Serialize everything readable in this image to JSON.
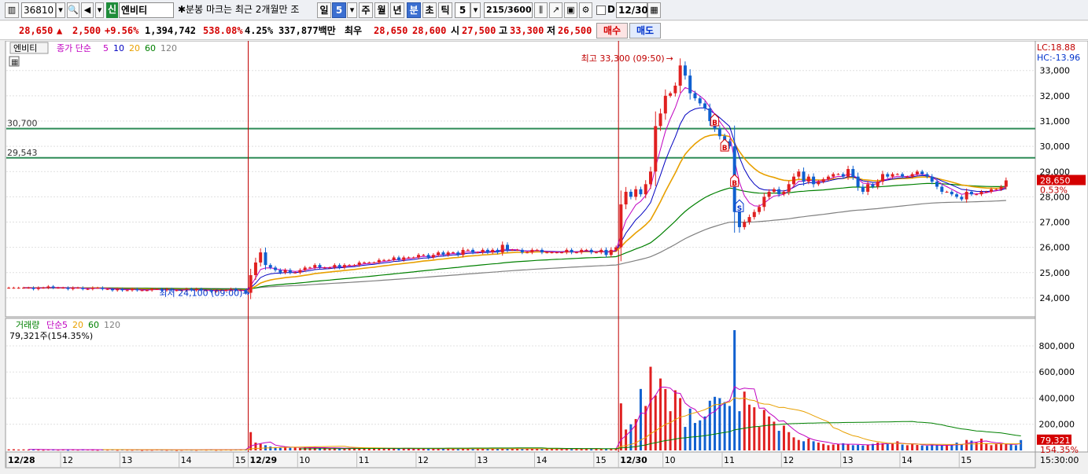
{
  "toolbar": {
    "code": "36810",
    "market_badge": "신",
    "stock_name": "엔비티",
    "notice": "✱분봉 마크는 최근 2개월만 조",
    "periods": [
      "일",
      "5",
      "주",
      "월",
      "년",
      "분",
      "초",
      "틱"
    ],
    "active_period": "분",
    "interval_value": "5",
    "count_display": "215/3600",
    "d_label": "D",
    "date_value": "12/30"
  },
  "quote": {
    "price": "28,650",
    "change_arrow": "▲",
    "change": "2,500",
    "change_pct": "+9.56%",
    "volume": "1,394,742",
    "volume_ratio": "538.08%",
    "turnover_pct": "4.25%",
    "trade_value": "337,877백만",
    "best_label": "최우",
    "ask": "28,650",
    "bid": "28,600",
    "open_label": "시",
    "open": "27,500",
    "high_label": "고",
    "high": "33,300",
    "low_label": "저",
    "low": "26,500",
    "buy_button": "매수",
    "sell_button": "매도"
  },
  "price_pane": {
    "name_tag": "엔비티",
    "legend": [
      {
        "text": "종가 단순",
        "color": "#c000c0"
      },
      {
        "text": "5",
        "color": "#c000c0"
      },
      {
        "text": "10",
        "color": "#0000c0"
      },
      {
        "text": "20",
        "color": "#e8a000"
      },
      {
        "text": "60",
        "color": "#008000"
      },
      {
        "text": "120",
        "color": "#808080"
      }
    ],
    "lc_label": "LC:18.88",
    "hc_label": "HC:-13.96",
    "hline1": "30,700",
    "hline2": "29,543",
    "max_annotation": "최고 33,300 (09:50)",
    "min_annotation": "최저 24,100 (09:00)",
    "last_price_tag": "28,650",
    "last_pct_tag": "0.53%",
    "y_ticks": [
      "33,000",
      "32,000",
      "31,000",
      "30,000",
      "29,000",
      "28,000",
      "27,000",
      "26,000",
      "25,000",
      "24,000"
    ],
    "signals": [
      "B",
      "B",
      "B",
      "S"
    ]
  },
  "volume_pane": {
    "legend": [
      {
        "text": "거래량",
        "color": "#008000"
      },
      {
        "text": "단순",
        "color": "#c000c0"
      },
      {
        "text": "5",
        "color": "#c000c0"
      },
      {
        "text": "20",
        "color": "#e8a000"
      },
      {
        "text": "60",
        "color": "#008000"
      },
      {
        "text": "120",
        "color": "#808080"
      }
    ],
    "sub_label": "79,321주(154.35%)",
    "y_ticks": [
      "800,000",
      "600,000",
      "400,000",
      "200,000"
    ],
    "last_vol_tag": "79,321",
    "last_pct_tag": "154.35%"
  },
  "x_axis": {
    "labels": [
      "12/28",
      "12",
      "13",
      "14",
      "15",
      "12/29",
      "10",
      "11",
      "12",
      "13",
      "14",
      "15",
      "12/30",
      "10",
      "11",
      "12",
      "13",
      "14",
      "15"
    ],
    "time_label": "15:30:00"
  },
  "chart_data": {
    "type": "candlestick",
    "price_range": [
      23500,
      33800
    ],
    "volume_range": [
      0,
      950000
    ],
    "days": [
      "12/28",
      "12/29",
      "12/30"
    ],
    "close": [
      24400,
      24400,
      24400,
      24400,
      24400,
      24350,
      24400,
      24400,
      24450,
      24400,
      24400,
      24400,
      24350,
      24400,
      24400,
      24350,
      24350,
      24400,
      24400,
      24350,
      24350,
      24300,
      24350,
      24300,
      24300,
      24350,
      24300,
      24300,
      24300,
      24350,
      24350,
      24300,
      24350,
      24300,
      24300,
      24300,
      24350,
      24300,
      24350,
      24300,
      24300,
      24250,
      24300,
      24300,
      24300,
      24350,
      24300,
      24300,
      24200,
      24900,
      25400,
      25800,
      25300,
      25200,
      25100,
      25000,
      25100,
      25000,
      25000,
      25100,
      25200,
      25200,
      25300,
      25200,
      25200,
      25200,
      25300,
      25200,
      25300,
      25300,
      25300,
      25400,
      25400,
      25400,
      25400,
      25500,
      25500,
      25500,
      25600,
      25500,
      25600,
      25600,
      25600,
      25700,
      25700,
      25600,
      25700,
      25800,
      25700,
      25800,
      25800,
      25700,
      25900,
      25900,
      25800,
      25800,
      25900,
      25800,
      25900,
      25800,
      26100,
      25900,
      25900,
      25900,
      25800,
      25800,
      25900,
      25900,
      25800,
      25800,
      25800,
      25800,
      25800,
      25900,
      25800,
      25800,
      25900,
      25900,
      25800,
      25800,
      25900,
      25700,
      25900,
      26000,
      27700,
      28200,
      28000,
      28300,
      28100,
      28500,
      29000,
      30800,
      31300,
      32000,
      32100,
      32400,
      33200,
      32800,
      32100,
      31900,
      31700,
      31500,
      31000,
      30700,
      30400,
      30200,
      30000,
      27400,
      26800,
      27000,
      27200,
      27400,
      27600,
      28000,
      28200,
      28300,
      28100,
      28200,
      28500,
      28800,
      29000,
      28600,
      28800,
      28500,
      28600,
      28700,
      28800,
      28900,
      28900,
      28800,
      29100,
      28800,
      28400,
      28200,
      28500,
      28400,
      28600,
      28900,
      28800,
      28900,
      28900,
      28800,
      28800,
      28900,
      29000,
      28900,
      28800,
      28600,
      28400,
      28200,
      28200,
      28100,
      28000,
      27900,
      28200,
      28100,
      28100,
      28200,
      28200,
      28300,
      28300,
      28400,
      28650
    ],
    "volume": [
      8000,
      9000,
      7000,
      8000,
      6000,
      9000,
      5000,
      4000,
      7000,
      6000,
      5000,
      8000,
      4000,
      6000,
      5000,
      7000,
      6000,
      5000,
      4000,
      6000,
      5000,
      7000,
      4000,
      6000,
      5000,
      4000,
      6000,
      3000,
      5000,
      4000,
      6000,
      5000,
      4000,
      5000,
      3000,
      4000,
      6000,
      5000,
      4000,
      6000,
      5000,
      7000,
      4000,
      5000,
      6000,
      5000,
      7000,
      6000,
      9000,
      140000,
      60000,
      50000,
      40000,
      30000,
      25000,
      22000,
      28000,
      20000,
      24000,
      18000,
      22000,
      20000,
      25000,
      21000,
      18000,
      16000,
      20000,
      17000,
      15000,
      18000,
      16000,
      14000,
      17000,
      15000,
      16000,
      13000,
      15000,
      14000,
      16000,
      12000,
      14000,
      13000,
      15000,
      12000,
      14000,
      11000,
      13000,
      12000,
      14000,
      12000,
      13000,
      11000,
      15000,
      12000,
      14000,
      11000,
      13000,
      12000,
      15000,
      14000,
      16000,
      13000,
      12000,
      14000,
      11000,
      13000,
      12000,
      14000,
      11000,
      12000,
      13000,
      10000,
      12000,
      11000,
      14000,
      12000,
      13000,
      11000,
      14000,
      12000,
      10000,
      12000,
      13000,
      16000,
      360000,
      160000,
      200000,
      240000,
      470000,
      340000,
      640000,
      420000,
      550000,
      470000,
      300000,
      460000,
      400000,
      180000,
      320000,
      210000,
      230000,
      260000,
      380000,
      410000,
      400000,
      370000,
      340000,
      920000,
      300000,
      450000,
      350000,
      330000,
      180000,
      310000,
      260000,
      220000,
      150000,
      190000,
      140000,
      100000,
      80000,
      70000,
      90000,
      70000,
      60000,
      50000,
      40000,
      45000,
      50000,
      55000,
      48000,
      40000,
      42000,
      38000,
      45000,
      50000,
      60000,
      55000,
      48000,
      52000,
      70000,
      45000,
      40000,
      50000,
      42000,
      38000,
      35000,
      45000,
      40000,
      38000,
      36000,
      42000,
      60000,
      45000,
      80000,
      75000,
      60000,
      90000,
      55000,
      40000,
      50000,
      48000,
      52000,
      45000,
      40000,
      79321
    ]
  }
}
